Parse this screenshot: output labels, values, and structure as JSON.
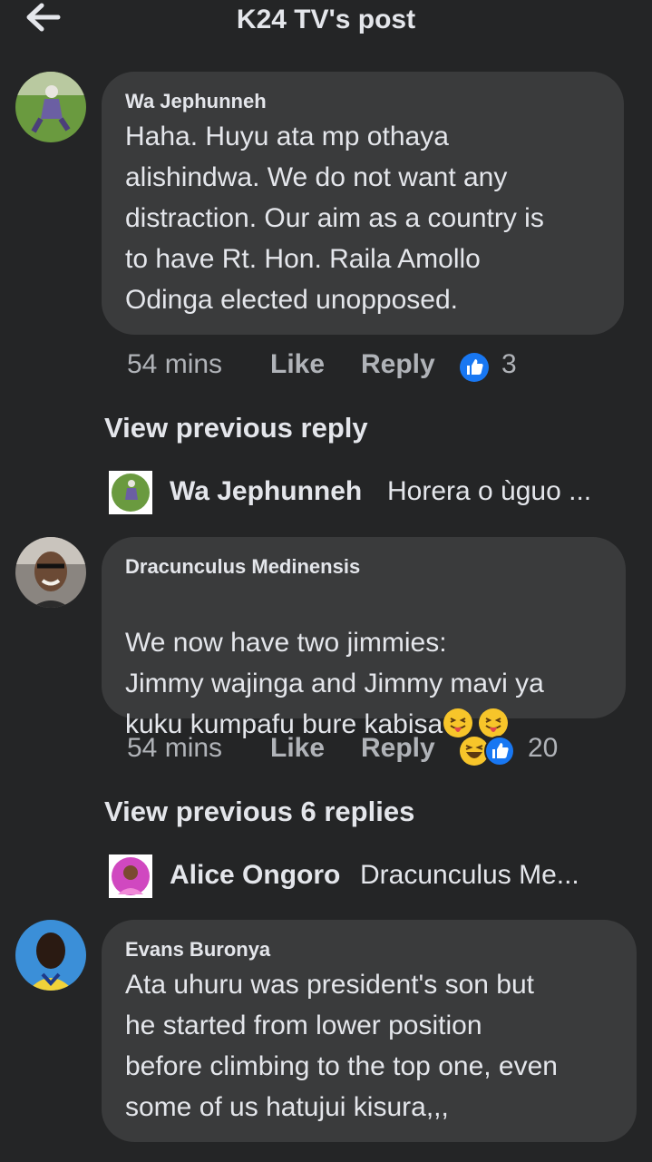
{
  "header": {
    "title": "K24 TV's post",
    "back_icon": "arrow-left-icon"
  },
  "comments": [
    {
      "author": "Wa Jephunneh",
      "text": "Haha. Huyu ata mp othaya\nalishindwa. We do not want any\ndistraction. Our aim as a country is\nto have Rt. Hon. Raila Amollo\nOdinga elected unopposed.",
      "time": "54 mins",
      "like_label": "Like",
      "reply_label": "Reply",
      "reaction_count": "3",
      "reactions": [
        "like-reaction-icon"
      ]
    },
    {
      "author": "Dracunculus Medinensis",
      "text": "We now have two jimmies:\nJimmy wajinga and Jimmy mavi ya\nkuku kumpafu bure kabisa",
      "time": "54 mins",
      "like_label": "Like",
      "reply_label": "Reply",
      "reaction_count": "20",
      "reactions": [
        "haha-reaction-icon",
        "like-reaction-icon"
      ]
    },
    {
      "author": "Evans Buronya",
      "text": "Ata uhuru was president's son but\nhe started from lower position\nbefore climbing to the top one, even\nsome of us hatujui kisura,,,"
    }
  ],
  "view_previous": [
    {
      "label": "View previous reply"
    },
    {
      "label": "View previous 6 replies"
    }
  ],
  "reply_previews": [
    {
      "name": "Wa Jephunneh",
      "text": "Horera o ùguo ..."
    },
    {
      "name": "Alice Ongoro",
      "text": "Dracunculus Me..."
    }
  ],
  "colors": {
    "background": "#242526",
    "bubble": "#3a3b3c",
    "primary_text": "#e4e6eb",
    "secondary_text": "#b0b3b8",
    "like_blue": "#1877f2"
  }
}
